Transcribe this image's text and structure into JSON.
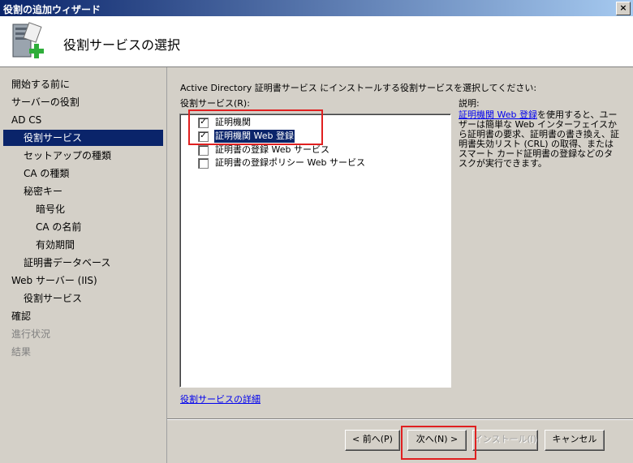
{
  "window": {
    "title": "役割の追加ウィザード",
    "close": "×"
  },
  "header": {
    "title": "役割サービスの選択"
  },
  "nav": [
    {
      "label": "開始する前に",
      "state": "normal"
    },
    {
      "label": "サーバーの役割",
      "state": "normal"
    },
    {
      "label": "AD CS",
      "state": "normal"
    },
    {
      "label": "役割サービス",
      "state": "selected"
    },
    {
      "label": "セットアップの種類",
      "state": "normal"
    },
    {
      "label": "CA の種類",
      "state": "normal"
    },
    {
      "label": "秘密キー",
      "state": "normal"
    },
    {
      "label": "暗号化",
      "state": "normal"
    },
    {
      "label": "CA の名前",
      "state": "normal"
    },
    {
      "label": "有効期間",
      "state": "normal"
    },
    {
      "label": "証明書データベース",
      "state": "normal"
    },
    {
      "label": "Web サーバー (IIS)",
      "state": "normal"
    },
    {
      "label": "役割サービス",
      "state": "normal"
    },
    {
      "label": "確認",
      "state": "normal"
    },
    {
      "label": "進行状況",
      "state": "disabled"
    },
    {
      "label": "結果",
      "state": "disabled"
    }
  ],
  "main": {
    "instruction": "Active Directory 証明書サービス にインストールする役割サービスを選択してください:",
    "services_label": "役割サービス(R):",
    "description_label": "説明:",
    "services": [
      {
        "label": "証明機関",
        "checked": true
      },
      {
        "label": "証明機関 Web 登録",
        "checked": true
      },
      {
        "label": "証明書の登録 Web サービス",
        "checked": false
      },
      {
        "label": "証明書の登録ポリシー Web サービス",
        "checked": false
      }
    ],
    "check_mark": "✓",
    "description_link": "証明機関 Web 登録",
    "description_text": "を使用すると、ユーザーは簡単な Web インターフェイスから証明書の要求、証明書の書き換え、証明書失効リスト (CRL) の取得、またはスマート カード証明書の登録などのタスクが実行できます。",
    "details_link": "役割サービスの詳細"
  },
  "buttons": {
    "back": "< 前へ(P)",
    "next": "次へ(N) >",
    "install": "インストール(I)",
    "cancel": "キャンセル"
  },
  "colors": {
    "highlight": "#0a246a",
    "annotation": "#e02020",
    "link": "#0000ee"
  }
}
